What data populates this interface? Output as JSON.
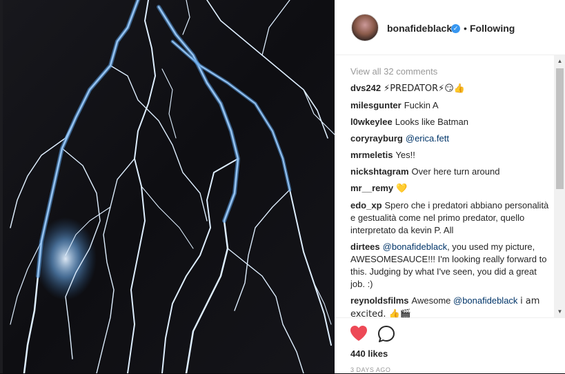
{
  "post": {
    "username": "bonafideblack",
    "separator": "•",
    "follow_status": "Following",
    "verified_glyph": "✓"
  },
  "comments": {
    "view_all": "View all 32 comments",
    "items": [
      {
        "user": "dvs242",
        "text": "⚡PREDATOR⚡😏👍"
      },
      {
        "user": "milesgunter",
        "text": "Fuckin A"
      },
      {
        "user": "l0wkeylee",
        "text": "Looks like Batman"
      },
      {
        "user": "coryrayburg",
        "mention": "@erica.fett",
        "text": ""
      },
      {
        "user": "mrmeletis",
        "text": "Yes!!"
      },
      {
        "user": "nickshtagram",
        "text": "Over here turn around"
      },
      {
        "user": "mr__remy",
        "text": "💛"
      },
      {
        "user": "edo_xp",
        "text": "Spero che i predatori abbiano personalità e gestualità come nel primo predator, quello interpretato da kevin P. All"
      },
      {
        "user": "dirtees",
        "mention": "@bonafideblack",
        "text": ", you used my picture, AWESOMESAUCE!!! I'm looking really forward to this. Judging by what I've seen, you did a great job. :)"
      },
      {
        "user": "reynoldsfilms",
        "text_before": "Awesome",
        "mention": "@bonafideblack",
        "text": "i am excited. 👍🎬"
      }
    ]
  },
  "actions": {
    "likes": "440 likes",
    "timestamp": "3 DAYS AGO"
  },
  "colors": {
    "heart": "#ed4956",
    "verified": "#3897f0",
    "mention": "#003569"
  },
  "icons": [
    "heart-icon",
    "comment-icon",
    "verified-icon"
  ]
}
